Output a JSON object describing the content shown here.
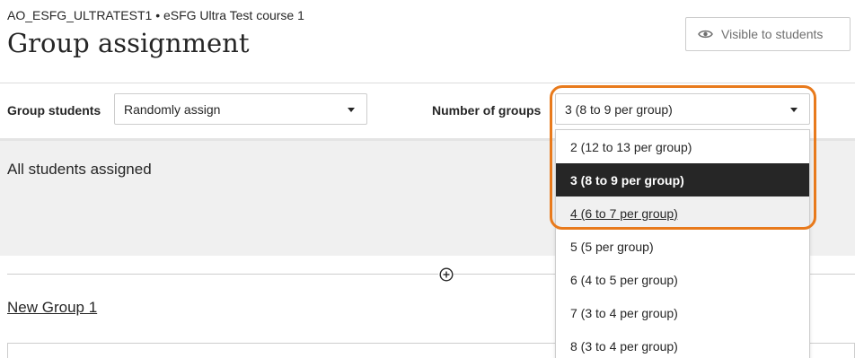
{
  "header": {
    "breadcrumb": "AO_ESFG_ULTRATEST1 • eSFG Ultra Test course 1",
    "title": "Group assignment",
    "visibility_label": "Visible to students"
  },
  "settings": {
    "group_students_label": "Group students",
    "group_students_value": "Randomly assign",
    "number_of_groups_label": "Number of groups",
    "number_of_groups_value": "3 (8 to 9 per group)"
  },
  "dropdown": {
    "options": [
      "2 (12 to 13 per group)",
      "3 (8 to 9 per group)",
      "4 (6 to 7 per group)",
      "5 (5 per group)",
      "6 (4 to 5 per group)",
      "7 (3 to 4 per group)",
      "8 (3 to 4 per group)"
    ],
    "selected_option": "3 (8 to 9 per group)",
    "hovered_option": "4 (6 to 7 per group)"
  },
  "assignment": {
    "status_heading": "All students assigned"
  },
  "groups": [
    {
      "name": "New Group 1"
    }
  ],
  "icons": {
    "visibility": "eye-icon",
    "dropdown": "caret-down-icon",
    "add_group": "plus-circle-icon"
  },
  "colors": {
    "highlight": "#e87a1c",
    "selected_option_bg": "#262626",
    "panel_bg": "#f0f0f0"
  }
}
